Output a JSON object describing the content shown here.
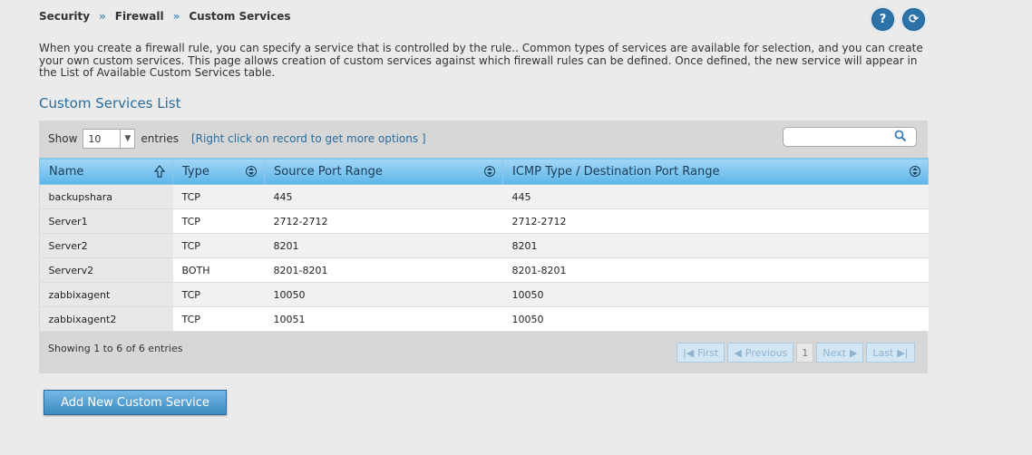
{
  "breadcrumb": [
    "Security",
    "Firewall",
    "Custom Services"
  ],
  "breadcrumb_sep": "»",
  "icons": {
    "help": "?",
    "refresh": "⟳"
  },
  "intro": "When you create a firewall rule, you can specify a service that is controlled by the rule.. Common types of services are available for selection, and you can create your own custom services. This page allows creation of custom services against which firewall rules can be defined. Once defined, the new service will appear in the List of Available Custom Services table.",
  "section_title": "Custom Services List",
  "toolbar": {
    "show_label": "Show",
    "page_size": "10",
    "entries_label": "entries",
    "hint": "[Right click on record to get more options ]"
  },
  "table": {
    "columns": [
      "Name",
      "Type",
      "Source Port Range",
      "ICMP Type / Destination Port Range"
    ],
    "rows": [
      [
        "backupshara",
        "TCP",
        "445",
        "445"
      ],
      [
        "Server1",
        "TCP",
        "2712-2712",
        "2712-2712"
      ],
      [
        "Server2",
        "TCP",
        "8201",
        "8201"
      ],
      [
        "Serverv2",
        "BOTH",
        "8201-8201",
        "8201-8201"
      ],
      [
        "zabbixagent",
        "TCP",
        "10050",
        "10050"
      ],
      [
        "zabbixagent2",
        "TCP",
        "10051",
        "10050"
      ]
    ]
  },
  "footer": {
    "info": "Showing 1 to 6 of 6 entries",
    "first": "First",
    "previous": "Previous",
    "page": "1",
    "next": "Next",
    "last": "Last"
  },
  "add_button": "Add New Custom Service",
  "colors": {
    "accent": "#2a6c9b",
    "header_bg": "#5db5ea",
    "page_bg": "#ebebeb"
  }
}
